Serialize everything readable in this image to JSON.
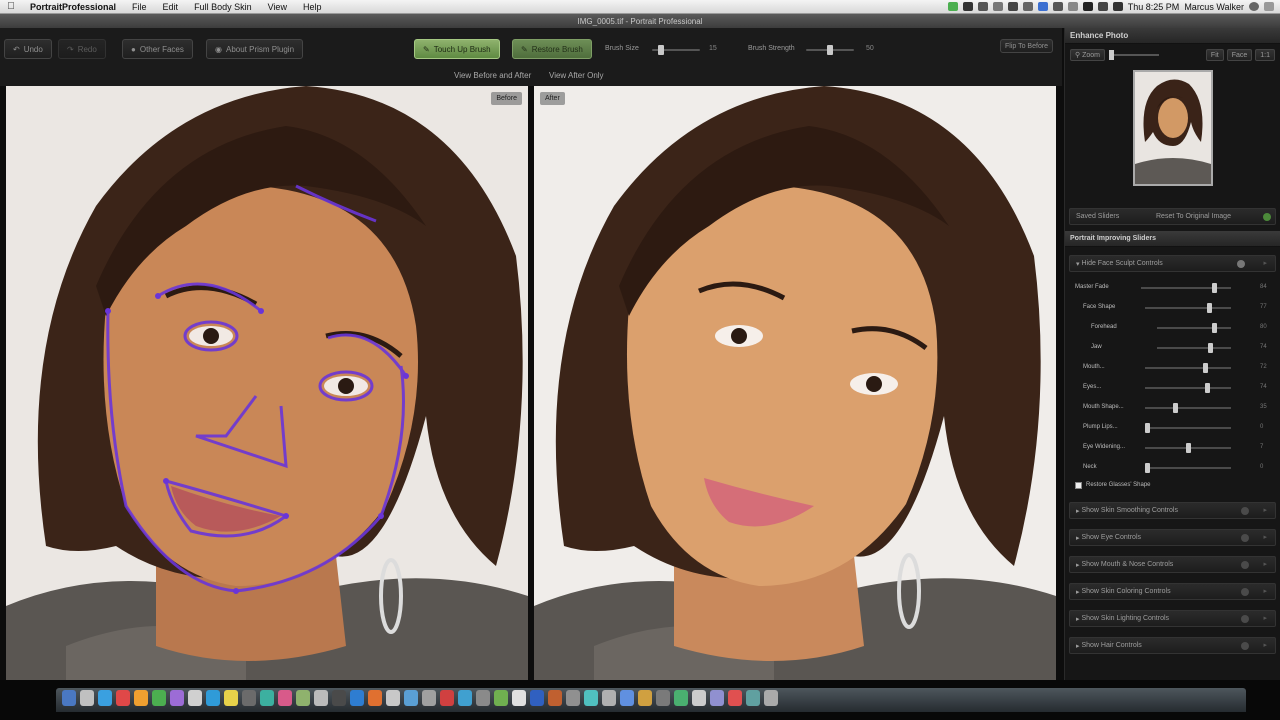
{
  "menubar": {
    "app_name": "PortraitProfessional",
    "items": [
      "File",
      "Edit",
      "Full Body Skin",
      "View",
      "Help"
    ],
    "time": "Thu 8:25 PM",
    "user": "Marcus Walker"
  },
  "window": {
    "title": "IMG_0005.tif - Portrait Professional"
  },
  "toolbar": {
    "undo": "Undo",
    "redo": "Redo",
    "other_faces": "Other Faces",
    "about_plugin": "About Prism Plugin",
    "touch_up_brush": "Touch Up Brush",
    "restore_brush": "Restore Brush",
    "brush_size_label": "Brush Size",
    "brush_size_value": "15",
    "brush_size_pct": 0.15,
    "brush_strength_label": "Brush Strength",
    "brush_strength_value": "50",
    "brush_strength_pct": 0.5,
    "flip_button": "Flip To Before",
    "view_before_after": "View Before and After",
    "view_after_only": "View After Only"
  },
  "panes": {
    "before_tag": "Before",
    "after_tag": "After"
  },
  "sidebar": {
    "enhance_header": "Enhance Photo",
    "zoom_label": "Zoom",
    "fit_button": "Fit",
    "face_button": "Face",
    "one_to_one_button": "1:1",
    "saved_sliders": "Saved Sliders",
    "reset_original": "Reset To Original Image",
    "sliders_header": "Portrait Improving Sliders",
    "sections_top": [
      {
        "label": "Hide Face Sculpt Controls"
      }
    ],
    "sliders": [
      {
        "label": "Master Fade",
        "value": "84",
        "pct": 0.84,
        "indent": 0
      },
      {
        "label": "Face Shape",
        "value": "77",
        "pct": 0.77,
        "indent": 1
      },
      {
        "label": "Forehead",
        "value": "80",
        "pct": 0.8,
        "indent": 2
      },
      {
        "label": "Jaw",
        "value": "74",
        "pct": 0.74,
        "indent": 2
      },
      {
        "label": "Mouth...",
        "value": "72",
        "pct": 0.72,
        "indent": 1
      },
      {
        "label": "Eyes...",
        "value": "74",
        "pct": 0.74,
        "indent": 1
      },
      {
        "label": "Mouth Shape...",
        "value": "35",
        "pct": 0.35,
        "indent": 1
      },
      {
        "label": "Plump Lips...",
        "value": "0",
        "pct": 0.0,
        "indent": 1
      },
      {
        "label": "Eye Widening...",
        "value": "7",
        "pct": 0.5,
        "indent": 1
      },
      {
        "label": "Neck",
        "value": "0",
        "pct": 0.0,
        "indent": 1
      }
    ],
    "checkbox_label": "Restore Glasses' Shape",
    "sections_bottom": [
      {
        "label": "Show Skin Smoothing Controls"
      },
      {
        "label": "Show Eye Controls"
      },
      {
        "label": "Show Mouth & Nose Controls"
      },
      {
        "label": "Show Skin Coloring Controls"
      },
      {
        "label": "Show Skin Lighting Controls"
      },
      {
        "label": "Show Hair Controls"
      }
    ]
  },
  "colors": {
    "accent_green": "#8fb26d",
    "overlay_purple": "#6a35d8"
  }
}
